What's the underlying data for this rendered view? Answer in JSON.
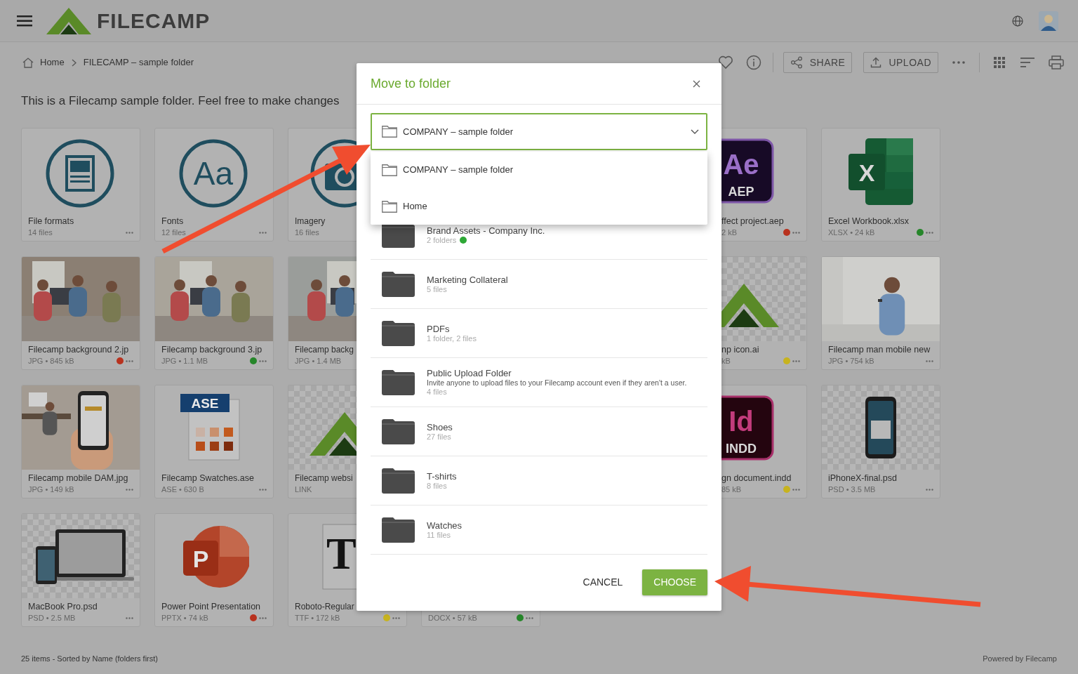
{
  "header": {
    "logo": "FILECAMP"
  },
  "breadcrumb": [
    "Home",
    "FILECAMP – sample folder"
  ],
  "toolbar": {
    "buttons": [
      {
        "label": "SHARE",
        "kind": "share"
      },
      {
        "label": "UPLOAD",
        "kind": "upload"
      }
    ]
  },
  "description": "This is a Filecamp sample folder. Feel free to make changes",
  "grid": {
    "rows": [
      {
        "left": [
          {
            "title": "File formats",
            "meta": "14 files",
            "kind": "formats"
          },
          {
            "title": "Fonts",
            "meta": "12 files",
            "kind": "fonts",
            "icon_text": [
              "Aa"
            ]
          },
          {
            "title": "Imagery",
            "meta": "16 files",
            "kind": "imagery"
          }
        ],
        "right": [
          {
            "title": "ffect project.aep",
            "meta": "2 kB",
            "kind": "aep",
            "color": "#b8321e",
            "icon_text": [
              "Ae",
              "AEP"
            ]
          },
          {
            "title": "Excel Workbook.xlsx",
            "meta": "XLSX • 24 kB",
            "kind": "xlsx",
            "color": "#26862a",
            "icon_text": [
              "X"
            ]
          }
        ]
      },
      {
        "left": [
          {
            "title": "Filecamp background 2.jp",
            "meta": "JPG • 845 kB",
            "color": "#b8321e"
          },
          {
            "title": "Filecamp background 3.jp",
            "meta": "JPG • 1.1 MB",
            "color": "#26862a"
          },
          {
            "title": "Filecamp backg",
            "meta": "JPG • 1.4 MB"
          }
        ],
        "right": [
          {
            "title": "np icon.ai",
            "meta": "kB",
            "kind": "logo",
            "color": "#c7b31e"
          },
          {
            "title": "Filecamp man mobile new",
            "meta": "JPG • 754 kB"
          }
        ]
      },
      {
        "left": [
          {
            "title": "Filecamp mobile DAM.jpg",
            "meta": "JPG • 149 kB"
          },
          {
            "title": "Filecamp Swatches.ase",
            "meta": "ASE • 630 B",
            "kind": "ase",
            "icon_text": [
              "ASE"
            ]
          },
          {
            "title": "Filecamp websi",
            "meta": "LINK",
            "kind": "logo"
          }
        ],
        "right": [
          {
            "title": "gn document.indd",
            "meta": "85 kB",
            "kind": "indd",
            "color": "#c7b31e",
            "icon_text": [
              "Id",
              "INDD"
            ]
          },
          {
            "title": "iPhoneX-final.psd",
            "meta": "PSD • 3.5 MB",
            "kind": "phone"
          }
        ]
      },
      {
        "left": [
          {
            "title": "MacBook Pro.psd",
            "meta": "PSD • 2.5 MB",
            "kind": "laptop"
          },
          {
            "title": "Power Point Presentation",
            "meta": "PPTX • 74 kB",
            "kind": "pptx",
            "color": "#b8321e",
            "icon_text": [
              "P"
            ]
          },
          {
            "title": "Roboto-Regular",
            "meta": "TTF • 172 kB",
            "kind": "ttf",
            "color": "#c7b31e",
            "icon_text": [
              "T"
            ]
          }
        ],
        "middle": [
          {
            "meta": "DOCX • 57 kB",
            "color": "#26862a"
          }
        ]
      }
    ]
  },
  "status": "25 items - Sorted by Name (folders first)",
  "powered_by": "Powered by Filecamp",
  "dialog": {
    "title": "Move to folder",
    "select": {
      "value": "COMPANY – sample folder",
      "expanded": true
    },
    "options": [
      {
        "label": "COMPANY – sample folder"
      },
      {
        "label": "Home"
      }
    ],
    "folders": [
      {
        "name": "Brand Assets - Company Inc.",
        "meta": "2 folders",
        "color": "#2ea836"
      },
      {
        "name": "Marketing Collateral",
        "meta": "5 files"
      },
      {
        "name": "PDFs",
        "meta": "1 folder, 2 files"
      },
      {
        "name": "Public Upload Folder",
        "description": "Invite anyone to upload files to your Filecamp account even if they aren't a user.",
        "meta": "4 files"
      },
      {
        "name": "Shoes",
        "meta": "27 files"
      },
      {
        "name": "T-shirts",
        "meta": "8 files"
      },
      {
        "name": "Watches",
        "meta": "11 files"
      }
    ],
    "buttons": [
      {
        "label": "CANCEL",
        "kind": "text"
      },
      {
        "label": "CHOOSE",
        "kind": "primary"
      }
    ]
  }
}
